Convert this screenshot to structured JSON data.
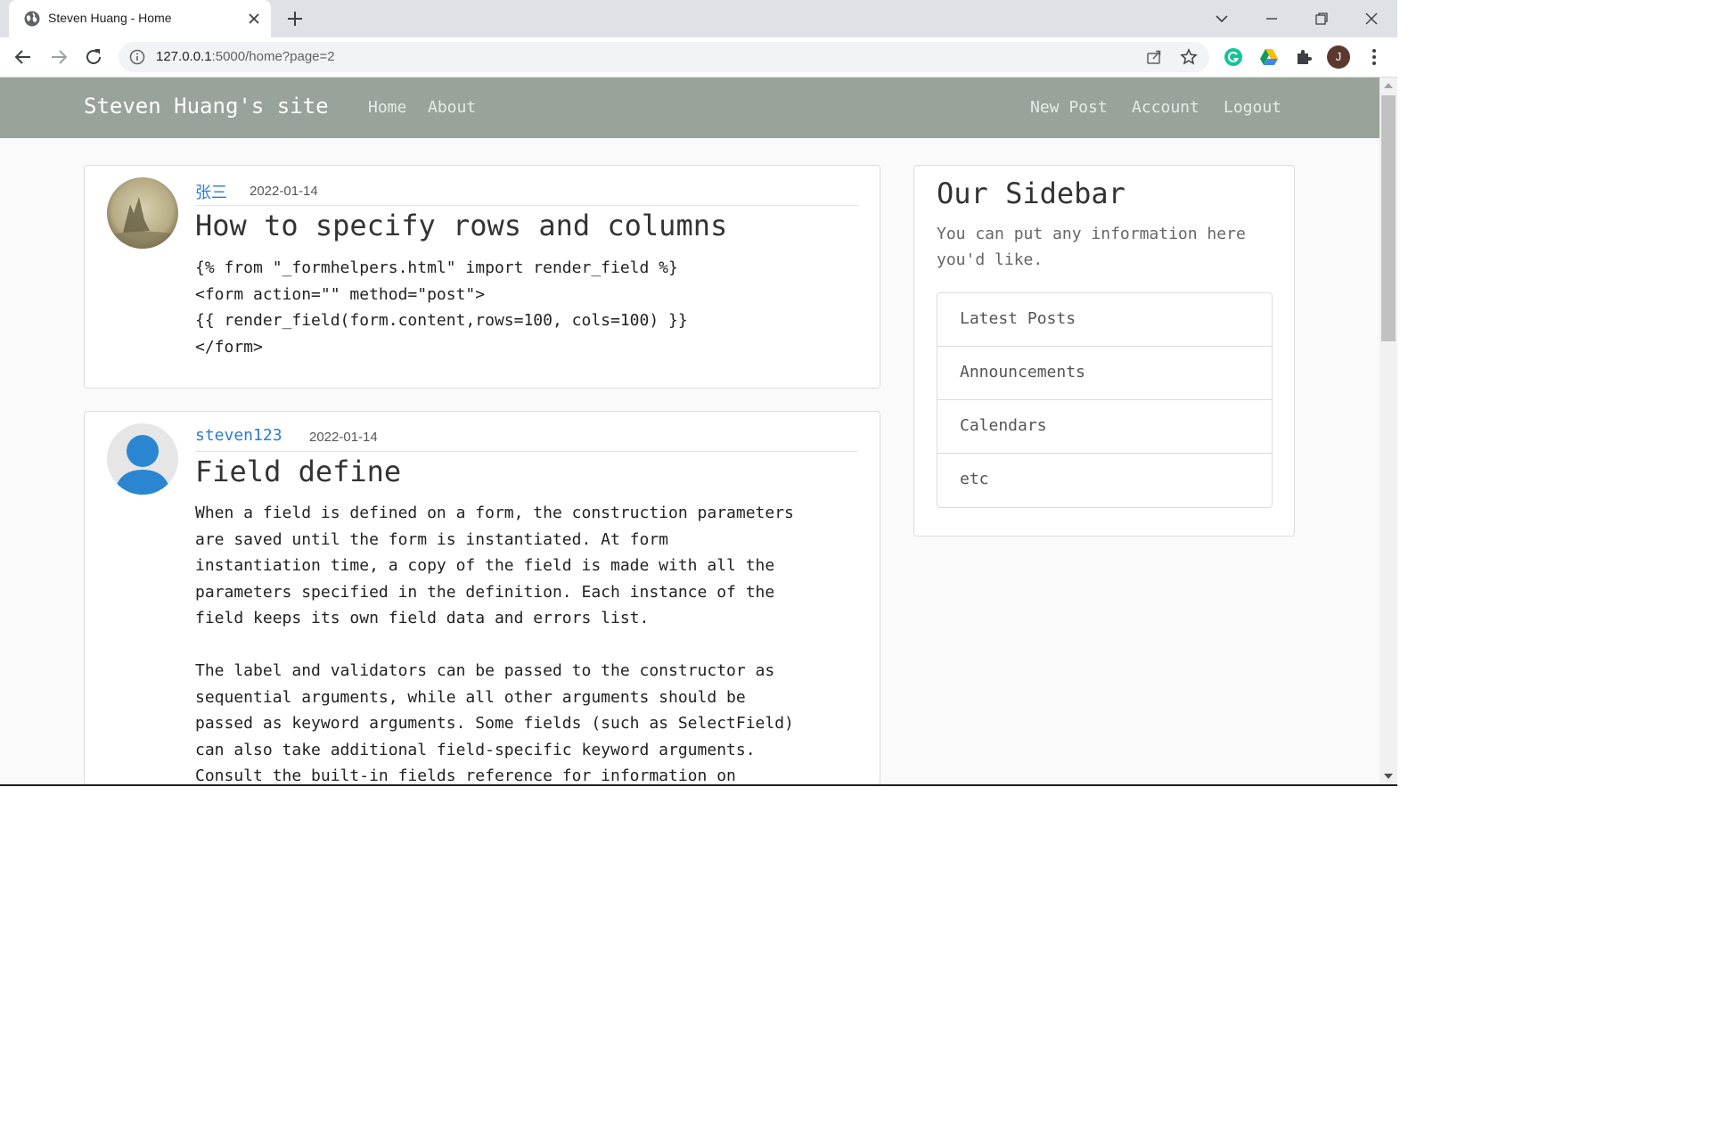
{
  "browser": {
    "tab_title": "Steven Huang - Home",
    "url_host": "127.0.0.1",
    "url_rest": ":5000/home?page=2",
    "profile_initial": "J"
  },
  "site": {
    "brand": "Steven Huang's site",
    "nav_left": [
      "Home",
      "About"
    ],
    "nav_right": [
      "New Post",
      "Account",
      "Logout"
    ]
  },
  "posts": [
    {
      "author": "张三",
      "date": "2022-01-14",
      "title": "How to specify rows and columns",
      "body": "{% from \"_formhelpers.html\" import render_field %}\n<form action=\"\" method=\"post\">\n{{ render_field(form.content,rows=100, cols=100) }}\n</form>"
    },
    {
      "author": "steven123",
      "date": "2022-01-14",
      "title": "Field define",
      "body": "When a field is defined on a form, the construction parameters\nare saved until the form is instantiated. At form\ninstantiation time, a copy of the field is made with all the\nparameters specified in the definition. Each instance of the\nfield keeps its own field data and errors list.\n\nThe label and validators can be passed to the constructor as\nsequential arguments, while all other arguments should be\npassed as keyword arguments. Some fields (such as SelectField)\ncan also take additional field-specific keyword arguments.\nConsult the built-in fields reference for information on"
    }
  ],
  "sidebar": {
    "title": "Our Sidebar",
    "text": "You can put any information here you'd like.",
    "items": [
      "Latest Posts",
      "Announcements",
      "Calendars",
      "etc"
    ]
  },
  "colors": {
    "navbar": "#99a399",
    "link": "#2b7bd0",
    "page_bg": "#fafafa"
  }
}
